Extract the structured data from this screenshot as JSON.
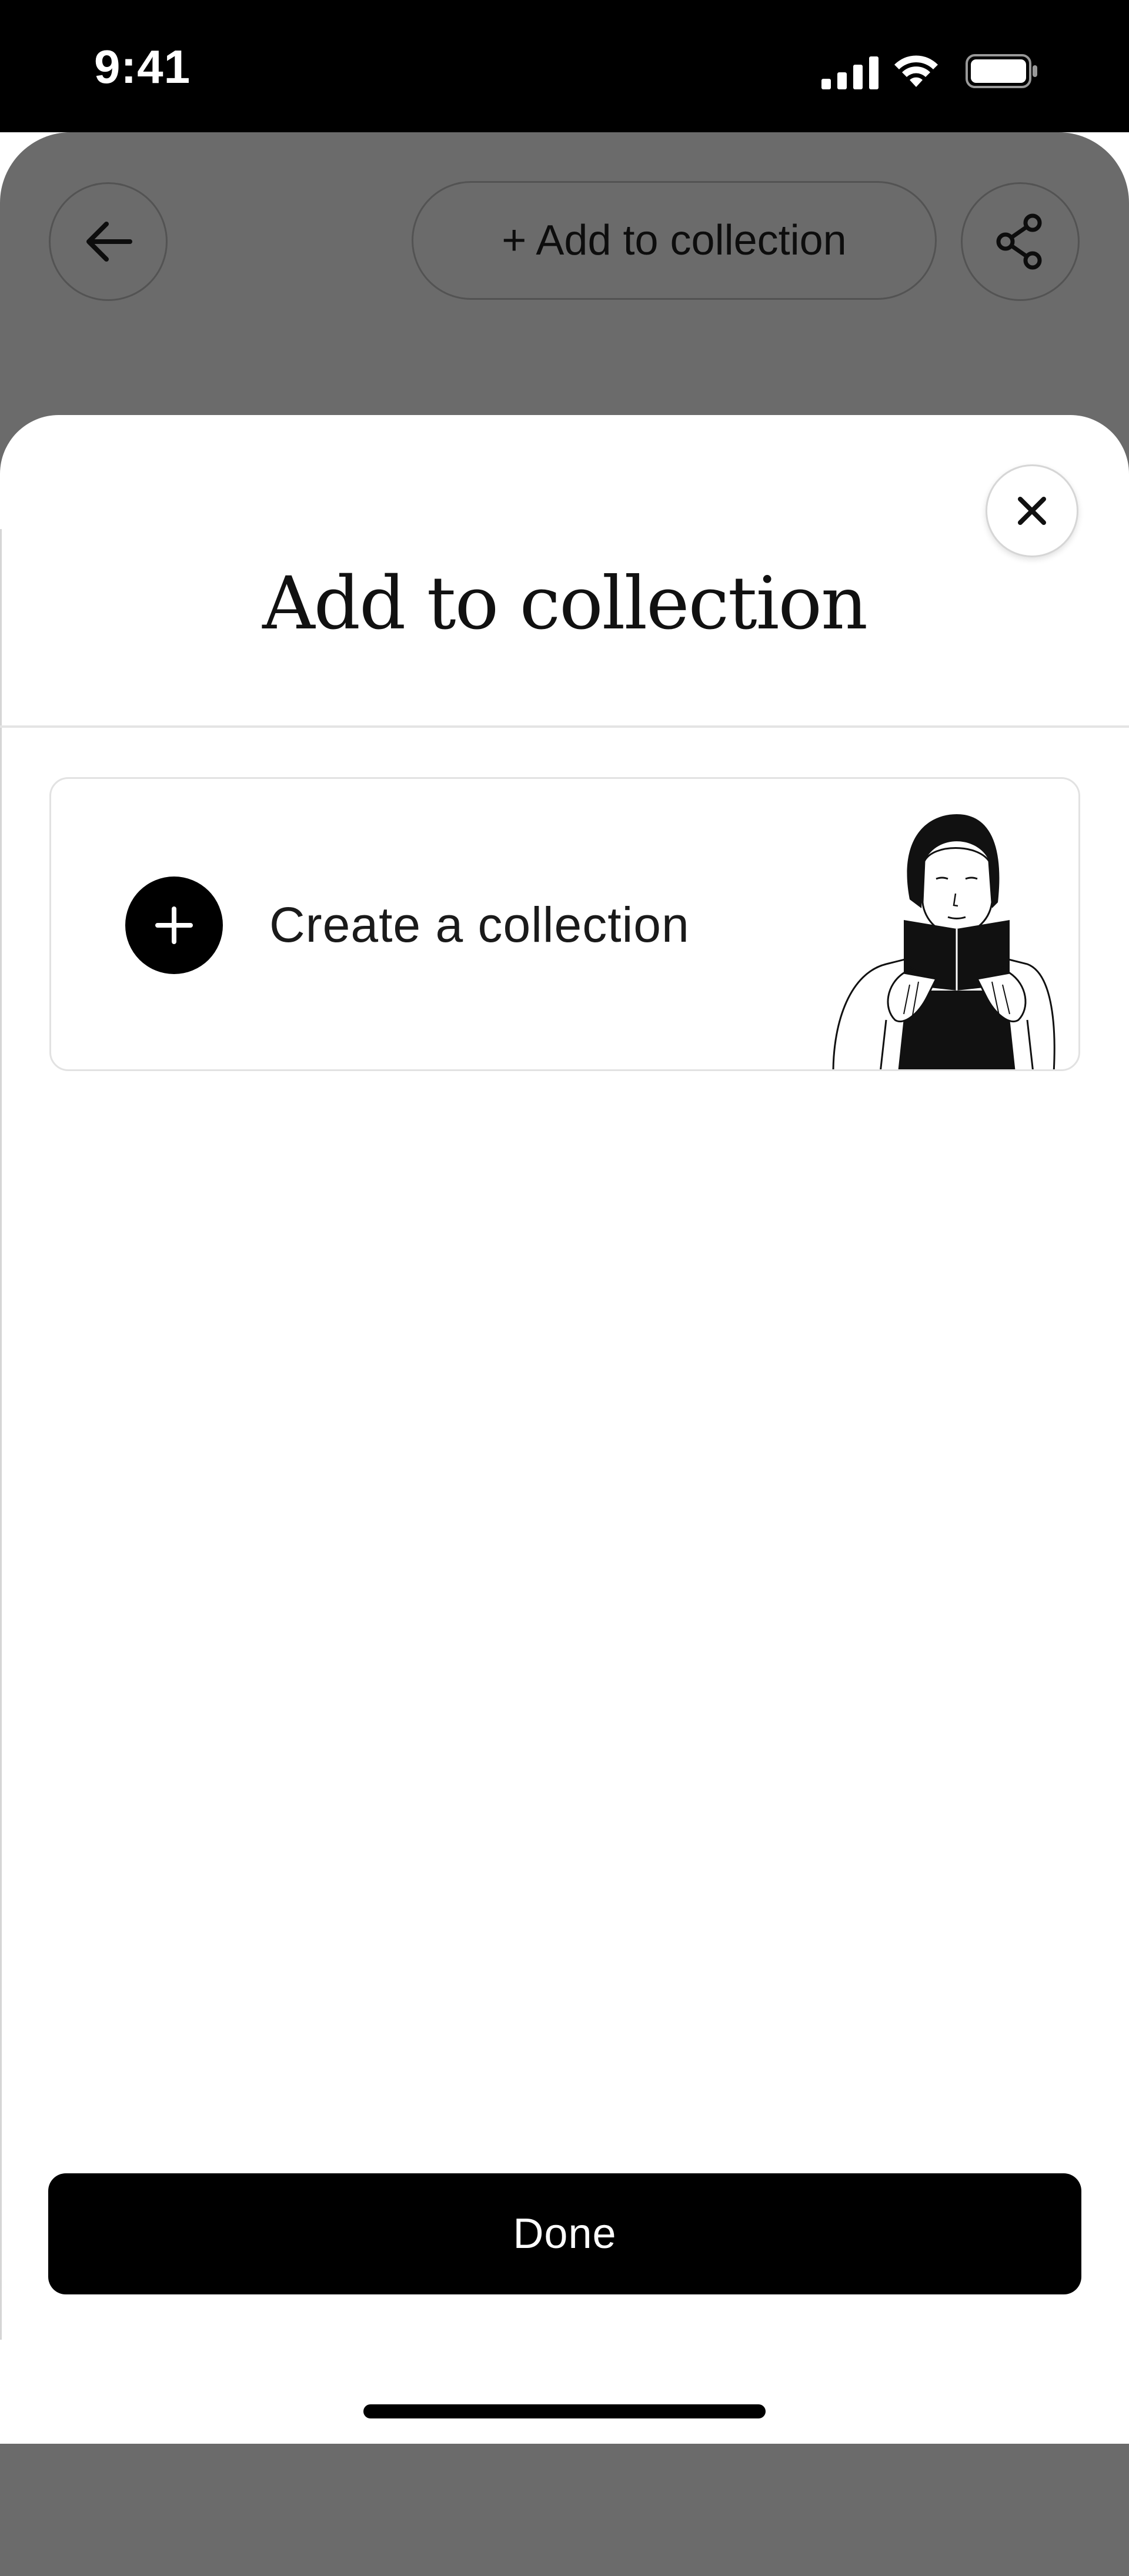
{
  "status_bar": {
    "time": "9:41"
  },
  "header": {
    "add_to_collection_label": "+ Add to collection"
  },
  "sheet": {
    "title": "Add to collection",
    "create_collection_label": "Create a collection",
    "done_label": "Done"
  },
  "icons": {
    "back": "arrow-left-icon",
    "share": "share-icon",
    "close": "close-icon",
    "plus": "plus-icon"
  },
  "colors": {
    "backdrop": "#6b6b6b",
    "primary": "#000000",
    "sheet_bg": "#ffffff"
  }
}
